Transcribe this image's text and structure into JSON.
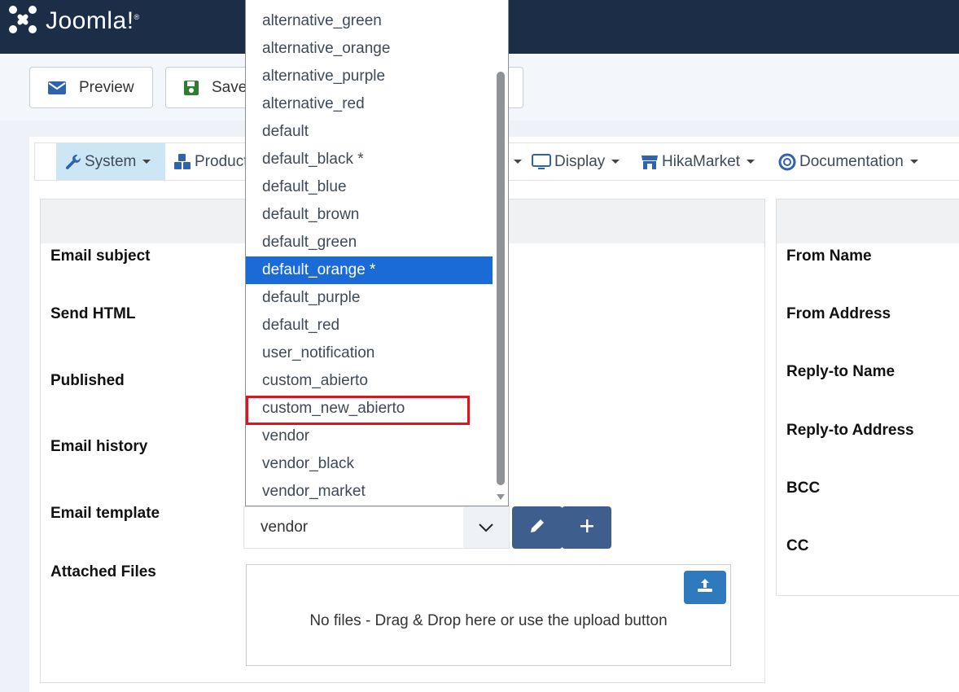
{
  "header": {
    "logo_text": "Joomla!",
    "logo_mark": "®"
  },
  "toolbar": {
    "preview_label": "Preview",
    "save_label": "Save"
  },
  "menu": {
    "items": [
      {
        "label": "System",
        "icon": "wrench-icon"
      },
      {
        "label": "Products",
        "icon": "cubes-icon"
      },
      {
        "label": "Display",
        "icon": "monitor-icon"
      },
      {
        "label": "HikaMarket",
        "icon": "store-icon"
      },
      {
        "label": "Documentation",
        "icon": "lifebuoy-icon"
      }
    ]
  },
  "form_left": {
    "labels": [
      "Email subject",
      "Send HTML",
      "Published",
      "Email history",
      "Email template",
      "Attached Files"
    ],
    "email_template_value": "vendor",
    "upload_text": "No files - Drag & Drop here or use the upload button"
  },
  "form_right": {
    "labels": [
      "From Name",
      "From Address",
      "Reply-to Name",
      "Reply-to Address",
      "BCC",
      "CC"
    ]
  },
  "dropdown": {
    "options": [
      "alternative_green",
      "alternative_orange",
      "alternative_purple",
      "alternative_red",
      "default",
      "default_black *",
      "default_blue",
      "default_brown",
      "default_green",
      "default_orange *",
      "default_purple",
      "default_red",
      "user_notification",
      "custom_abierto",
      "custom_new_abierto",
      "vendor",
      "vendor_black",
      "vendor_market"
    ],
    "selected": "default_orange *",
    "highlighted": "custom_new_abierto"
  },
  "colors": {
    "header_bg": "#1c2d48",
    "selected_bg": "#1a6bd8",
    "highlight_border": "#e0141e",
    "button_blue": "#3e5f8e",
    "upload_blue": "#2f79bd"
  }
}
